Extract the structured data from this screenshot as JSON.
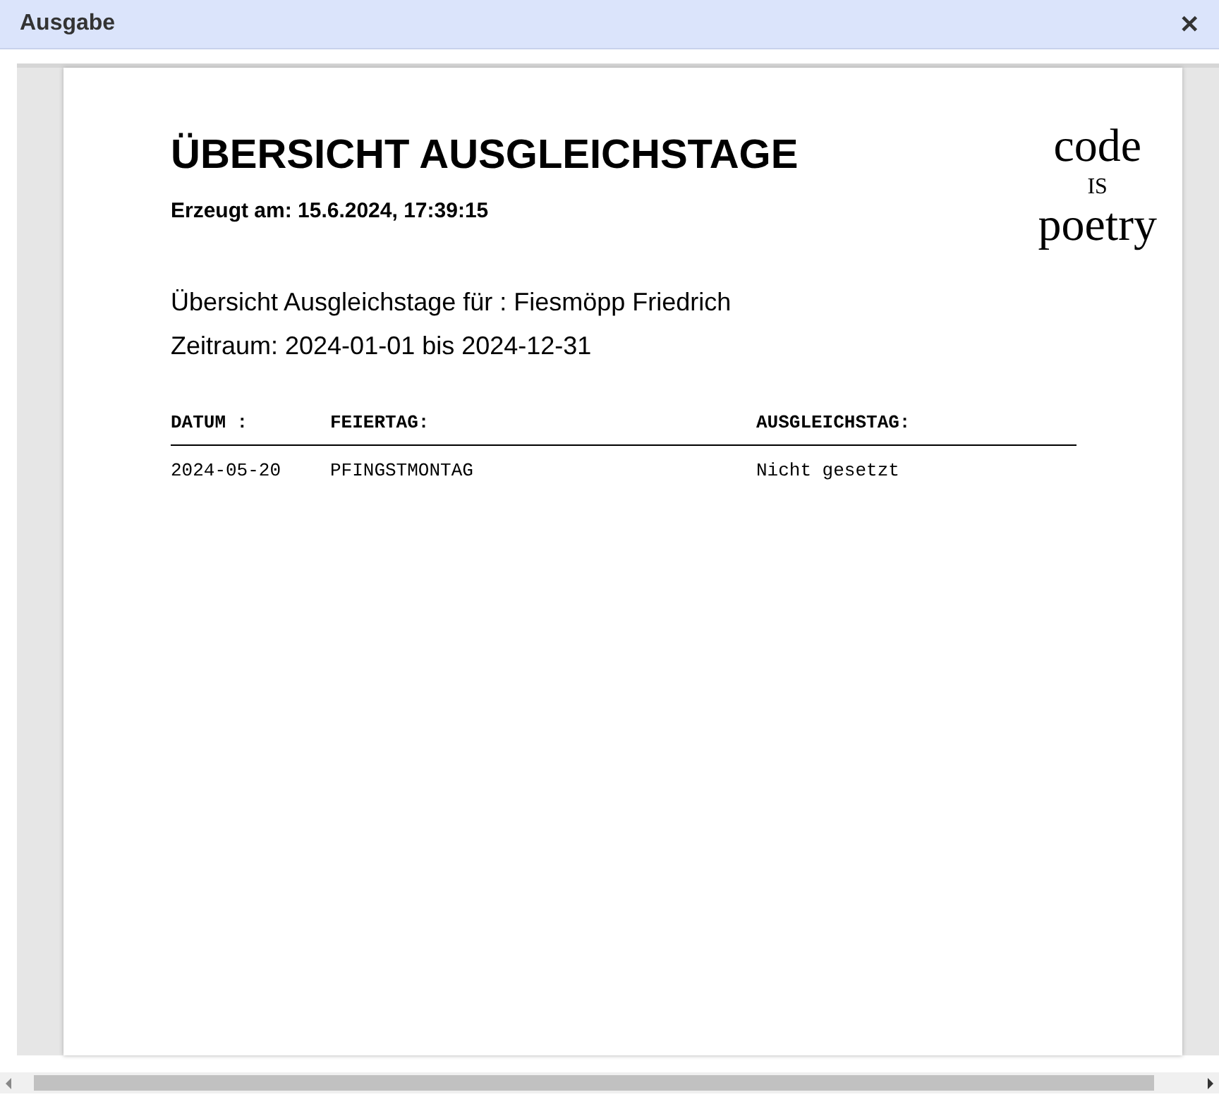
{
  "window": {
    "title": "Ausgabe",
    "close": "✕"
  },
  "document": {
    "title": "ÜBERSICHT AUSGLEICHSTAGE",
    "created": "Erzeugt am: 15.6.2024, 17:39:15",
    "logo": [
      "code",
      "IS",
      "poetry"
    ],
    "info": [
      "Übersicht Ausgleichstage für : Fiesmöpp Friedrich",
      "Zeitraum: 2024-01-01 bis 2024-12-31"
    ],
    "table": {
      "columns": [
        "DATUM :",
        "FEIERTAG:",
        "AUSGLEICHSTAG:"
      ],
      "rows": [
        [
          "2024-05-20",
          "PFINGSTMONTAG",
          "Nicht gesetzt"
        ]
      ]
    }
  }
}
